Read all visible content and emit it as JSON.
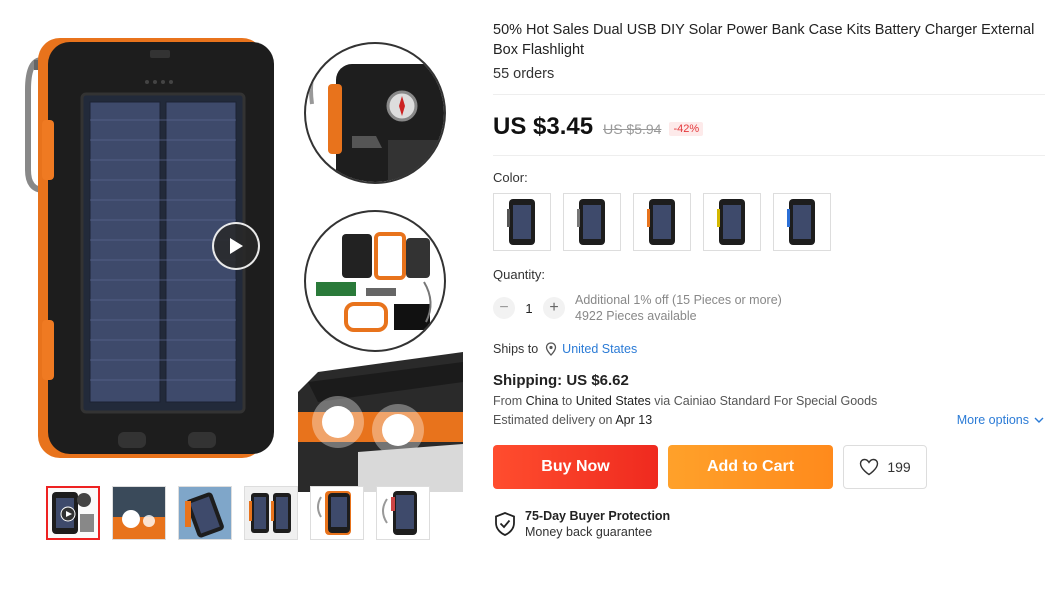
{
  "product": {
    "title": "50% Hot Sales Dual USB DIY Solar Power Bank Case Kits Battery Charger External Box Flashlight",
    "orders": "55 orders"
  },
  "price": {
    "current": "US $3.45",
    "original": "US $5.94",
    "discount": "-42%"
  },
  "color": {
    "label": "Color:",
    "options_count": 5
  },
  "quantity": {
    "label": "Quantity:",
    "minus": "−",
    "value": "1",
    "plus": "+",
    "note1": "Additional 1% off (15 Pieces or more)",
    "note2": "4922 Pieces available"
  },
  "shipping": {
    "ships_to_label": "Ships to",
    "ships_to_country": "United States",
    "cost": "Shipping: US $6.62",
    "from_label": "From",
    "from_country": "China",
    "to_label": "to",
    "to_country": "United States",
    "via": "via Cainiao Standard For Special Goods",
    "estimated_label": "Estimated delivery on",
    "estimated_date": "Apr 13",
    "more_options": "More options"
  },
  "actions": {
    "buy_now": "Buy Now",
    "add_to_cart": "Add to Cart",
    "wishlist_count": "199"
  },
  "protection": {
    "title": "75-Day Buyer Protection",
    "subtitle": "Money back guarantee"
  },
  "colors": {
    "accent_red": "#e4393c",
    "link_blue": "#2b7bd6",
    "buy_orange_red": "#f33a23",
    "cart_orange": "#ff951f"
  },
  "icons": [
    "play-icon",
    "location-pin-icon",
    "chevron-down-icon",
    "heart-icon",
    "shield-check-icon"
  ]
}
